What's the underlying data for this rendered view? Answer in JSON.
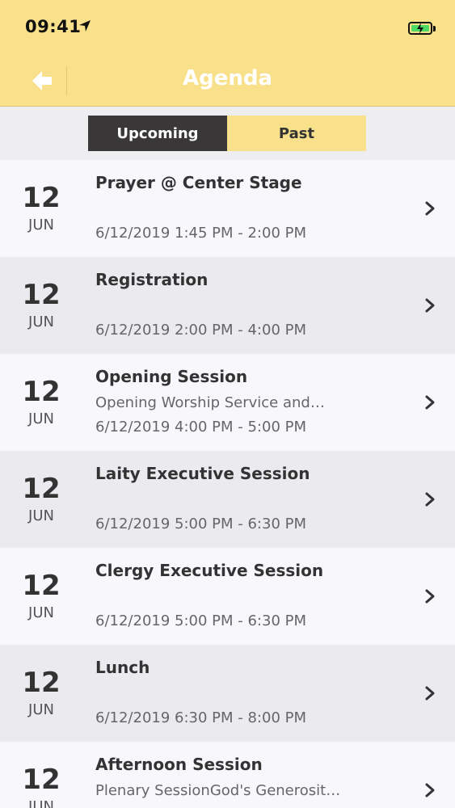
{
  "status_bar": {
    "time": "09:41"
  },
  "nav": {
    "title": "Agenda",
    "back_icon": "back-arrow-icon"
  },
  "tabs": [
    {
      "label": "Upcoming",
      "active": true
    },
    {
      "label": "Past",
      "active": false
    }
  ],
  "colors": {
    "accent": "#f9e08b",
    "active_tab": "#3a3738",
    "battery": "#4cd964"
  },
  "events": [
    {
      "day": "12",
      "month": "JUN",
      "title": "Prayer @ Center Stage",
      "description": "",
      "time": "6/12/2019 1:45 PM - 2:00 PM"
    },
    {
      "day": "12",
      "month": "JUN",
      "title": "Registration",
      "description": "",
      "time": "6/12/2019 2:00 PM - 4:00 PM"
    },
    {
      "day": "12",
      "month": "JUN",
      "title": "Opening Session",
      "description": "Opening Worship Service and…",
      "time": "6/12/2019 4:00 PM - 5:00 PM"
    },
    {
      "day": "12",
      "month": "JUN",
      "title": "Laity Executive Session",
      "description": "",
      "time": "6/12/2019 5:00 PM - 6:30 PM"
    },
    {
      "day": "12",
      "month": "JUN",
      "title": "Clergy Executive Session",
      "description": "",
      "time": "6/12/2019 5:00 PM - 6:30 PM"
    },
    {
      "day": "12",
      "month": "JUN",
      "title": "Lunch",
      "description": "",
      "time": "6/12/2019 6:30 PM - 8:00 PM"
    },
    {
      "day": "12",
      "month": "JUN",
      "title": "Afternoon Session",
      "description": "Plenary SessionGod's Generosit…",
      "time": ""
    }
  ]
}
